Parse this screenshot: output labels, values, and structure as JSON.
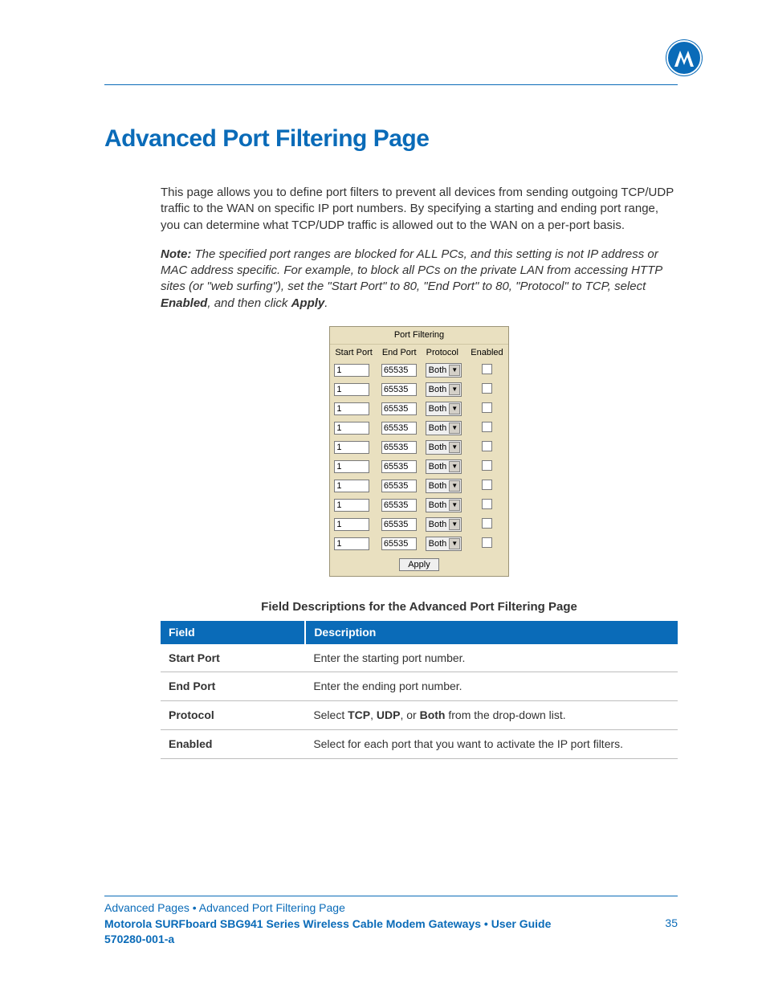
{
  "heading": "Advanced Port Filtering Page",
  "intro": "This page allows you to define port filters to prevent all devices from sending outgoing TCP/UDP traffic to the WAN on specific IP port numbers. By specifying a starting and ending port range, you can determine what TCP/UDP traffic is allowed out to the WAN on a per-port basis.",
  "note_label": "Note:",
  "note_before": " The specified port ranges are blocked for ALL PCs, and this setting is not IP address or MAC address specific. For example, to block all PCs on the private LAN from accessing HTTP sites (or \"web surfing\"), set the \"Start Port\" to 80, \"End Port\" to 80, \"Protocol\" to TCP, select ",
  "note_b1": "Enabled",
  "note_mid": ", and then click ",
  "note_b2": "Apply",
  "note_end": ".",
  "port_filtering": {
    "title": "Port Filtering",
    "headers": {
      "start": "Start Port",
      "end": "End Port",
      "protocol": "Protocol",
      "enabled": "Enabled"
    },
    "apply_label": "Apply",
    "rows": [
      {
        "start": "1",
        "end": "65535",
        "protocol": "Both",
        "enabled": false
      },
      {
        "start": "1",
        "end": "65535",
        "protocol": "Both",
        "enabled": false
      },
      {
        "start": "1",
        "end": "65535",
        "protocol": "Both",
        "enabled": false
      },
      {
        "start": "1",
        "end": "65535",
        "protocol": "Both",
        "enabled": false
      },
      {
        "start": "1",
        "end": "65535",
        "protocol": "Both",
        "enabled": false
      },
      {
        "start": "1",
        "end": "65535",
        "protocol": "Both",
        "enabled": false
      },
      {
        "start": "1",
        "end": "65535",
        "protocol": "Both",
        "enabled": false
      },
      {
        "start": "1",
        "end": "65535",
        "protocol": "Both",
        "enabled": false
      },
      {
        "start": "1",
        "end": "65535",
        "protocol": "Both",
        "enabled": false
      },
      {
        "start": "1",
        "end": "65535",
        "protocol": "Both",
        "enabled": false
      }
    ]
  },
  "fd_title": "Field Descriptions for the Advanced Port Filtering Page",
  "fd_headers": {
    "field": "Field",
    "desc": "Description"
  },
  "fd_rows": [
    {
      "field": "Start Port",
      "desc_pre": "Enter the starting port number.",
      "b1": "",
      "mid": "",
      "b2": "",
      "mid2": "",
      "b3": "",
      "post": ""
    },
    {
      "field": "End Port",
      "desc_pre": "Enter the ending port number.",
      "b1": "",
      "mid": "",
      "b2": "",
      "mid2": "",
      "b3": "",
      "post": ""
    },
    {
      "field": "Protocol",
      "desc_pre": "Select ",
      "b1": "TCP",
      "mid": ", ",
      "b2": "UDP",
      "mid2": ", or ",
      "b3": "Both",
      "post": " from the drop-down list."
    },
    {
      "field": "Enabled",
      "desc_pre": "Select for each port that you want to activate the IP port filters.",
      "b1": "",
      "mid": "",
      "b2": "",
      "mid2": "",
      "b3": "",
      "post": ""
    }
  ],
  "footer": {
    "breadcrumb": "Advanced Pages • Advanced Port Filtering Page",
    "title_line1": "Motorola SURFboard SBG941 Series Wireless Cable Modem Gateways • User Guide",
    "title_line2": "570280-001-a",
    "page_no": "35"
  }
}
